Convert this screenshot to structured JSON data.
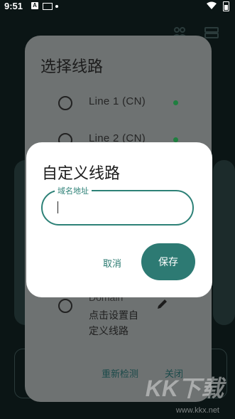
{
  "status_bar": {
    "time": "9:51",
    "notif_letter": "A"
  },
  "sheet": {
    "title": "选择线路",
    "lines": [
      {
        "label": "Line 1 (CN)",
        "status_color": "#1f7f3f"
      },
      {
        "label": "Line 2 (CN)",
        "status_color": "#1f7f3f"
      }
    ],
    "custom_line": {
      "label": "Domain",
      "hint": "点击设置自定义线路"
    },
    "retest_label": "重新检测",
    "close_label": "关闭"
  },
  "dialog": {
    "title": "自定义线路",
    "field_label": "域名地址",
    "field_value": "",
    "cancel_label": "取消",
    "save_label": "保存"
  },
  "watermark": {
    "logo": "KK下载",
    "url": "www.kkx.net"
  },
  "colors": {
    "accent": "#2d7a73",
    "dialog_bg": "#ffffff",
    "sheet_bg": "#6e7272"
  }
}
